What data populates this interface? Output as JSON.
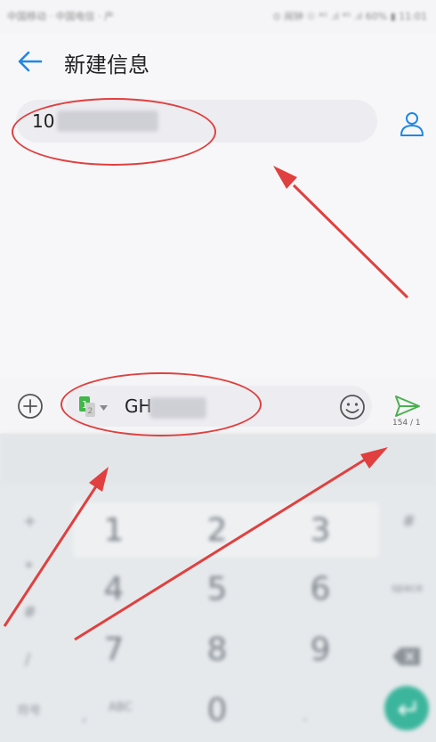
{
  "status_bar": {
    "left_text": "中国移动 · 中国电信 · 产",
    "right_text": "⊙ 闹钟 ☉ ⁴ᴳ .ıl ⁴ᴳ .ıl 60% ▮ 11:01"
  },
  "header": {
    "title": "新建信息"
  },
  "recipient": {
    "value": "10"
  },
  "compose": {
    "message": "GH",
    "counter": "154 / 1"
  },
  "keyboard": {
    "digits": [
      "1",
      "2",
      "3",
      "4",
      "5",
      "6",
      "7",
      "8",
      "9",
      "0"
    ],
    "side_keys": {
      "plus": "+",
      "star": "*",
      "hash": "#",
      "slash": "/",
      "comma": ",",
      "period": ".",
      "symbol": "符号",
      "abc": "ABC",
      "space": "space"
    }
  },
  "colors": {
    "accent": "#1e88e5",
    "send": "#4caf50",
    "annotation": "#e0403f",
    "enter": "#3bb59c"
  }
}
